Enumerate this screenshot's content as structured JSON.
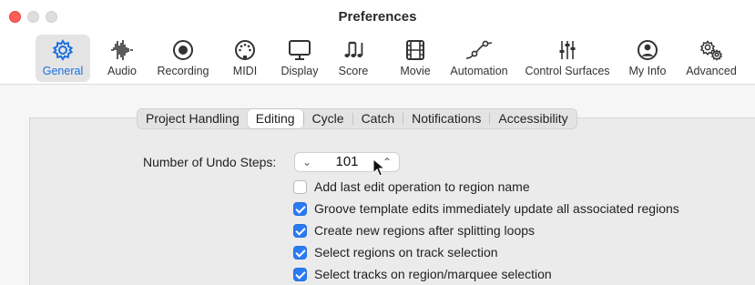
{
  "window": {
    "title": "Preferences"
  },
  "toolbar": {
    "items": [
      {
        "label": "General",
        "icon": "gear-icon",
        "selected": true
      },
      {
        "label": "Audio",
        "icon": "waveform-icon",
        "selected": false
      },
      {
        "label": "Recording",
        "icon": "record-icon",
        "selected": false
      },
      {
        "label": "MIDI",
        "icon": "midi-port-icon",
        "selected": false
      },
      {
        "label": "Display",
        "icon": "monitor-icon",
        "selected": false
      },
      {
        "label": "Score",
        "icon": "music-notes-icon",
        "selected": false
      },
      {
        "label": "Movie",
        "icon": "film-icon",
        "selected": false
      },
      {
        "label": "Automation",
        "icon": "automation-curve-icon",
        "selected": false
      },
      {
        "label": "Control Surfaces",
        "icon": "faders-icon",
        "selected": false
      },
      {
        "label": "My Info",
        "icon": "person-icon",
        "selected": false
      },
      {
        "label": "Advanced",
        "icon": "gears-icon",
        "selected": false
      }
    ],
    "accent_color": "#1a6fe0"
  },
  "tabs": [
    {
      "label": "Project Handling",
      "selected": false
    },
    {
      "label": "Editing",
      "selected": true
    },
    {
      "label": "Cycle",
      "selected": false
    },
    {
      "label": "Catch",
      "selected": false
    },
    {
      "label": "Notifications",
      "selected": false
    },
    {
      "label": "Accessibility",
      "selected": false
    }
  ],
  "undo": {
    "label": "Number of Undo Steps:",
    "value": "101",
    "down_glyph": "⌄",
    "up_glyph": "⌃"
  },
  "options": [
    {
      "label": "Add last edit operation to region name",
      "checked": false
    },
    {
      "label": "Groove template edits immediately update all associated regions",
      "checked": true
    },
    {
      "label": "Create new regions after splitting loops",
      "checked": true
    },
    {
      "label": "Select regions on track selection",
      "checked": true
    },
    {
      "label": "Select tracks on region/marquee selection",
      "checked": true
    }
  ],
  "colors": {
    "checkbox_checked": "#2b7bf3",
    "close_button": "#fe5f57"
  }
}
